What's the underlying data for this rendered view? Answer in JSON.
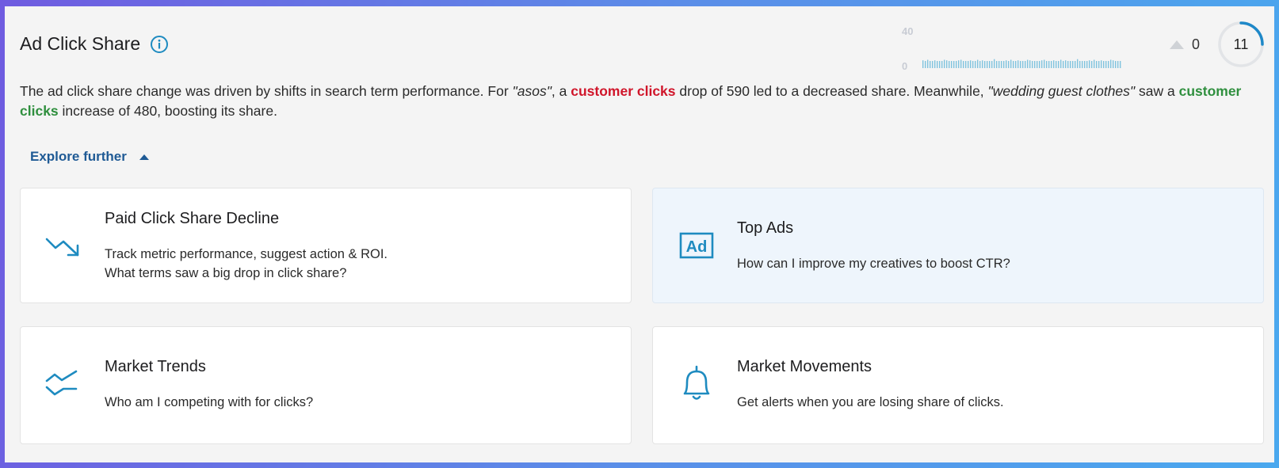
{
  "header": {
    "title": "Ad Click Share"
  },
  "sparkline": {
    "y_max_label": "40",
    "y_min_label": "0",
    "color": "#7fc3de"
  },
  "trend": {
    "value": "0"
  },
  "score": {
    "value": "11",
    "accent": "#1e88c8"
  },
  "summary": {
    "p1": "The ad click share change was driven by shifts in search term performance. For ",
    "term1": "\"asos\"",
    "p2": ", a ",
    "metric1": "customer clicks",
    "p3": " drop of 590 led to a decreased share. Meanwhile, ",
    "term2": "\"wedding guest clothes\"",
    "p4": " saw a ",
    "metric2": "customer clicks",
    "p5": " increase of 480, boosting its share."
  },
  "explore": {
    "label": "Explore further"
  },
  "cards": [
    {
      "title": "Paid Click Share Decline",
      "line1": "Track metric performance, suggest action & ROI.",
      "line2": "What terms saw a big drop in click share?",
      "icon": "trending-down-icon"
    },
    {
      "title": "Top Ads",
      "line1": "How can I improve my creatives to boost CTR?",
      "icon": "ad-icon",
      "icon_text": "Ad"
    },
    {
      "title": "Market Trends",
      "line1": "Who am I competing with for clicks?",
      "icon": "market-trends-icon"
    },
    {
      "title": "Market Movements",
      "line1": "Get alerts when you are losing share of clicks.",
      "icon": "bell-icon"
    }
  ],
  "colors": {
    "icon_blue": "#1e8bc0",
    "link_blue": "#1f5a95",
    "negative": "#d0152a",
    "positive": "#2f8f3e"
  }
}
